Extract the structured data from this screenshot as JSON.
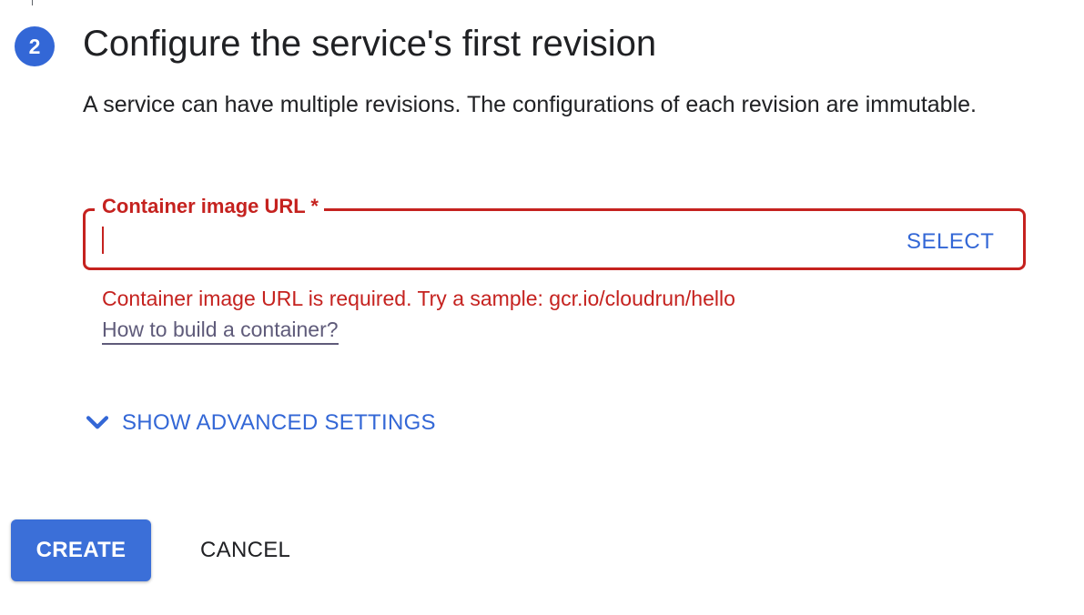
{
  "step": {
    "number": "2",
    "title": "Configure the service's first revision",
    "description": "A service can have multiple revisions. The configurations of each revision are immutable."
  },
  "container_field": {
    "label": "Container image URL *",
    "value": "",
    "select_label": "SELECT",
    "error": "Container image URL is required. Try a sample: gcr.io/cloudrun/hello",
    "help_link": "How to build a container?"
  },
  "advanced": {
    "label": "SHOW ADVANCED SETTINGS",
    "icon": "chevron-down-icon"
  },
  "actions": {
    "create_label": "CREATE",
    "cancel_label": "CANCEL"
  },
  "colors": {
    "primary": "#3367d6",
    "error": "#c5221f",
    "text": "#202124"
  }
}
